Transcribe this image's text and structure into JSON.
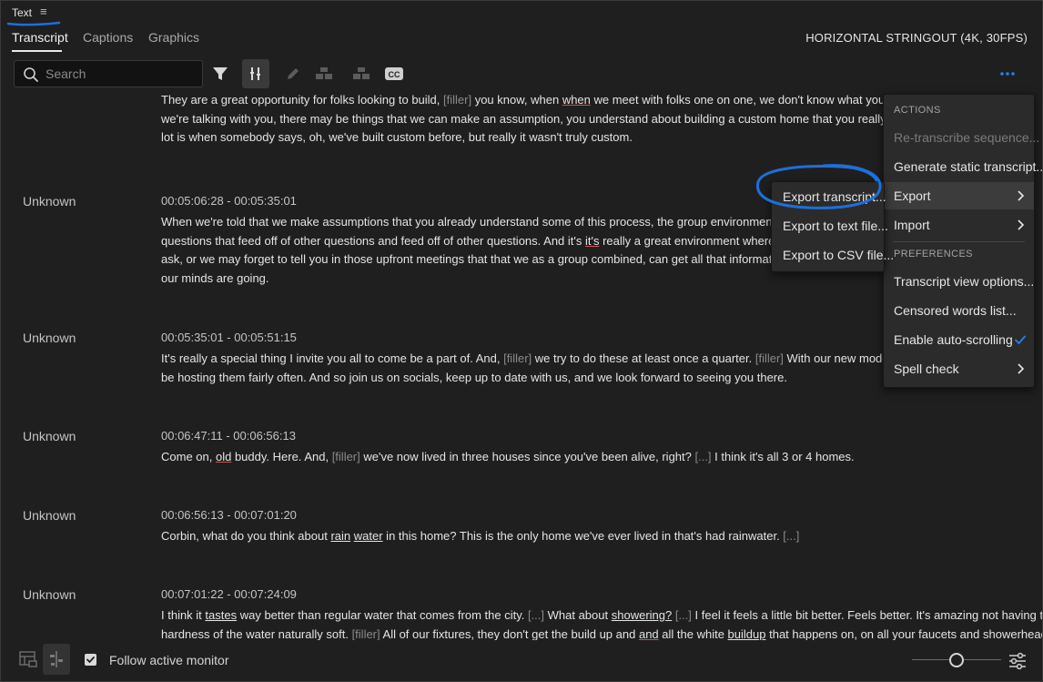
{
  "panel": {
    "title": "Text",
    "menu_glyph": "≡"
  },
  "tabs": [
    {
      "label": "Transcript",
      "active": true
    },
    {
      "label": "Captions",
      "active": false
    },
    {
      "label": "Graphics",
      "active": false
    }
  ],
  "sequence_name": "HORIZONTAL STRINGOUT (4K, 30FPS)",
  "toolbar": {
    "search_placeholder": "Search",
    "icons": [
      "filter-icon",
      "align-icon",
      "pencil-icon",
      "merge-segments-icon",
      "split-segment-icon",
      "captions-icon",
      "more-icon"
    ],
    "cc_label": "CC"
  },
  "segments": [
    {
      "speaker": "",
      "timecode": "",
      "lines": [
        [
          "They are a great opportunity for folks looking to build, ",
          {
            "f": "[filler]"
          },
          " you know, when ",
          {
            "u": "when"
          },
          " we meet with folks one on one, we don't know what you don"
        ],
        [
          "we're talking with you, there may be things that we can make an assumption, you understand about building a custom home that you really don't"
        ],
        [
          "lot is when somebody says, oh, we've built custom before, but really it wasn't truly custom."
        ]
      ]
    },
    {
      "speaker": "Unknown",
      "timecode": "00:05:06:28 - 00:05:35:01",
      "lines": [
        [
          "When we're told that we make assumptions that you already understand some of this process, the group environment of th"
        ],
        [
          "questions that feed off of other questions and feed off of other questions. And it's ",
          {
            "u": "it's"
          },
          " really a great environment where there"
        ],
        [
          "ask, or we may forget to tell you in those upfront meetings that that we as a group combined, can get all that information flo"
        ],
        [
          "our minds are going."
        ]
      ]
    },
    {
      "speaker": "Unknown",
      "timecode": "00:05:35:01 - 00:05:51:15",
      "lines": [
        [
          "It's really a special thing I invite you all to come be a part of. And, ",
          {
            "f": "[filler]"
          },
          " we try to do these at least once a quarter. ",
          {
            "f": "[filler]"
          },
          " With our new model hom"
        ],
        [
          "be hosting them fairly often. And so join us on socials, keep up to date with us, and we look forward to seeing you there."
        ]
      ]
    },
    {
      "speaker": "Unknown",
      "timecode": "00:06:47:11 - 00:06:56:13",
      "lines": [
        [
          "Come on, ",
          {
            "u": "old"
          },
          " buddy. Here. And, ",
          {
            "f": "[filler]"
          },
          " we've now lived in three houses since you've been alive, right? ",
          {
            "f": "[...]"
          },
          " I think it's all 3 or 4 homes."
        ]
      ]
    },
    {
      "speaker": "Unknown",
      "timecode": "00:06:56:13 - 00:07:01:20",
      "lines": [
        [
          "Corbin, what do you think about ",
          {
            "ul": "rain"
          },
          " ",
          {
            "ul": "water"
          },
          " in this home? This is the only home we've ever lived in that's had rainwater. ",
          {
            "f": "[...]"
          }
        ]
      ]
    },
    {
      "speaker": "Unknown",
      "timecode": "00:07:01:22 - 00:07:24:09",
      "lines": [
        [
          "I think it ",
          {
            "ul": "tastes"
          },
          " way better than regular water that comes from the city. ",
          {
            "f": "[...]"
          },
          " What about ",
          {
            "ul": "showering?"
          },
          " ",
          {
            "f": "[...]"
          },
          " I feel it feels a little bit better. Feels better. It's amazing not having the"
        ],
        [
          "hardness of the water naturally soft. ",
          {
            "f": "[filler]"
          },
          " All of our fixtures, they don't get the build up and ",
          {
            "u": "and"
          },
          " all the white ",
          {
            "ul": "buildup"
          },
          " that happens on, on all your faucets and showerheads."
        ]
      ]
    }
  ],
  "menu": {
    "actions_header": "ACTIONS",
    "retranscribe": "Re-transcribe sequence...",
    "generate_static": "Generate static transcript...",
    "export": "Export",
    "import": "Import",
    "preferences_header": "PREFERENCES",
    "view_options": "Transcript view options...",
    "censored": "Censored words list...",
    "autoscroll": "Enable auto-scrolling",
    "spellcheck": "Spell check"
  },
  "export_submenu": {
    "transcript": "Export transcript...",
    "text_file": "Export to text file...",
    "csv_file": "Export to CSV file..."
  },
  "footer": {
    "follow_label": "Follow active monitor",
    "follow_checked": true,
    "zoom_level": 0.5
  },
  "colors": {
    "accent": "#2680eb",
    "annotation": "#1e6fd9",
    "spell_underline": "#d15050"
  }
}
